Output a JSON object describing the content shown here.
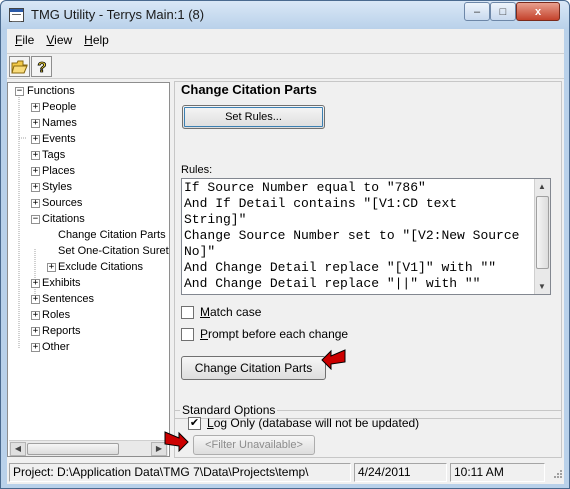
{
  "window": {
    "title": "TMG Utility - Terrys Main:1 (8)",
    "controls": {
      "minimize": "–",
      "maximize": "□",
      "close": "x"
    }
  },
  "menu": [
    {
      "label": "File",
      "accel": "F"
    },
    {
      "label": "View",
      "accel": "V"
    },
    {
      "label": "Help",
      "accel": "H"
    }
  ],
  "toolbar": {
    "open_icon": "folder-open-icon",
    "help_icon": "help-icon"
  },
  "tree": {
    "root": "Functions",
    "items": [
      "People",
      "Names",
      "Events",
      "Tags",
      "Places",
      "Styles",
      "Sources",
      "Citations"
    ],
    "citations_children": [
      "Change Citation Parts",
      "Set One-Citation Surety",
      "Exclude Citations"
    ],
    "items_after": [
      "Exhibits",
      "Sentences",
      "Roles",
      "Reports",
      "Other"
    ]
  },
  "panel": {
    "title": "Change Citation Parts",
    "set_rules_label": "Set Rules...",
    "rules_label": "Rules:",
    "rules_lines": [
      "If Source Number equal to \"786\"",
      "And If Detail contains \"[V1:CD text",
      "String]\"",
      "Change Source Number set to \"[V2:New Source",
      "No]\"",
      "And Change Detail replace \"[V1]\" with \"\"",
      "And Change Detail replace \"||\" with \"\""
    ],
    "match_case": {
      "label": "Match case",
      "accel": "M",
      "checked": false
    },
    "prompt": {
      "label": "Prompt before each change",
      "accel": "P",
      "checked": false
    },
    "action_button": "Change Citation Parts"
  },
  "standard_options": {
    "label": "Standard Options",
    "log_only": {
      "label": "Log Only",
      "accel": "L",
      "suffix": " (database will not be updated)",
      "checked": true
    },
    "filter_button": "<Filter Unavailable>"
  },
  "status": {
    "project": "Project: D:\\Application Data\\TMG 7\\Data\\Projects\\temp\\",
    "date": "4/24/2011",
    "time": "10:11 AM"
  },
  "colors": {
    "arrow": "#cc0000",
    "arrow_outline": "#000000"
  }
}
